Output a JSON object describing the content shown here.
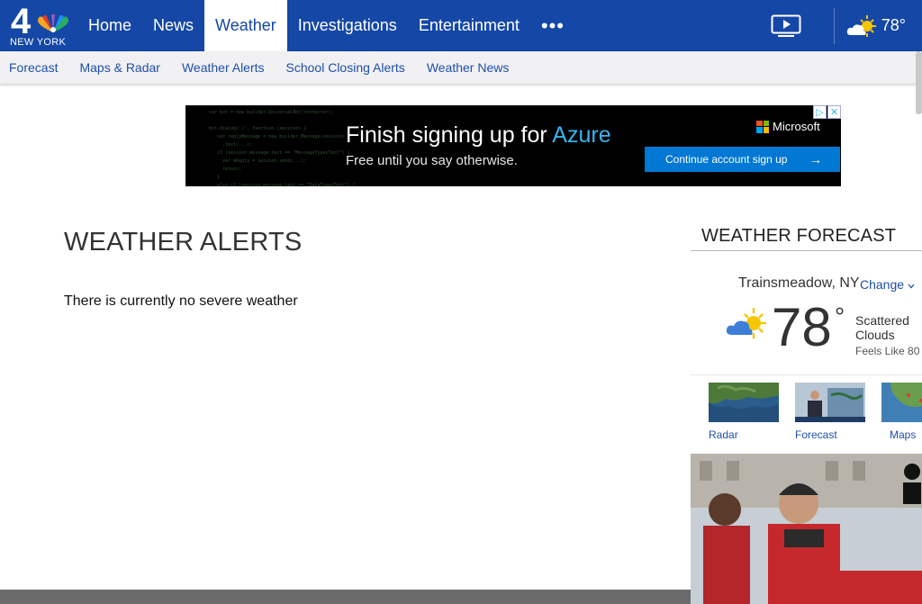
{
  "nav": {
    "logo_text": "NEW YORK",
    "logo_number": "4",
    "items": [
      {
        "label": "Home"
      },
      {
        "label": "News"
      },
      {
        "label": "Weather"
      },
      {
        "label": "Investigations"
      },
      {
        "label": "Entertainment"
      },
      {
        "label": "•••"
      }
    ],
    "active": "Weather",
    "current_temp": "78°"
  },
  "subnav": {
    "items": [
      {
        "label": "Forecast"
      },
      {
        "label": "Maps & Radar"
      },
      {
        "label": "Weather Alerts"
      },
      {
        "label": "School Closing Alerts"
      },
      {
        "label": "Weather News"
      }
    ]
  },
  "ad": {
    "headline_pre": "Finish signing up for ",
    "headline_brand": "Azure",
    "subline": "Free until you say otherwise.",
    "brand": "Microsoft",
    "cta": "Continue account sign up",
    "cta_arrow": "→",
    "adchoice_play": "▷",
    "adchoice_close": "✕"
  },
  "main": {
    "title": "WEATHER ALERTS",
    "message": "There is currently no severe weather"
  },
  "sidebar": {
    "title": "WEATHER FORECAST",
    "location": "Trainsmeadow, NY",
    "change_label": "Change",
    "temp": "78",
    "degree": "°",
    "condition_line1": "Scattered",
    "condition_line2": "Clouds",
    "feels_like": "Feels Like 80 °",
    "thumbs": [
      {
        "label": "Radar"
      },
      {
        "label": "Forecast"
      },
      {
        "label": "Maps"
      }
    ]
  },
  "colors": {
    "nav_blue": "#1547a6",
    "link_blue": "#1f4fa8",
    "azure_blue": "#3ab3ec",
    "cta_blue": "#0078d4"
  }
}
